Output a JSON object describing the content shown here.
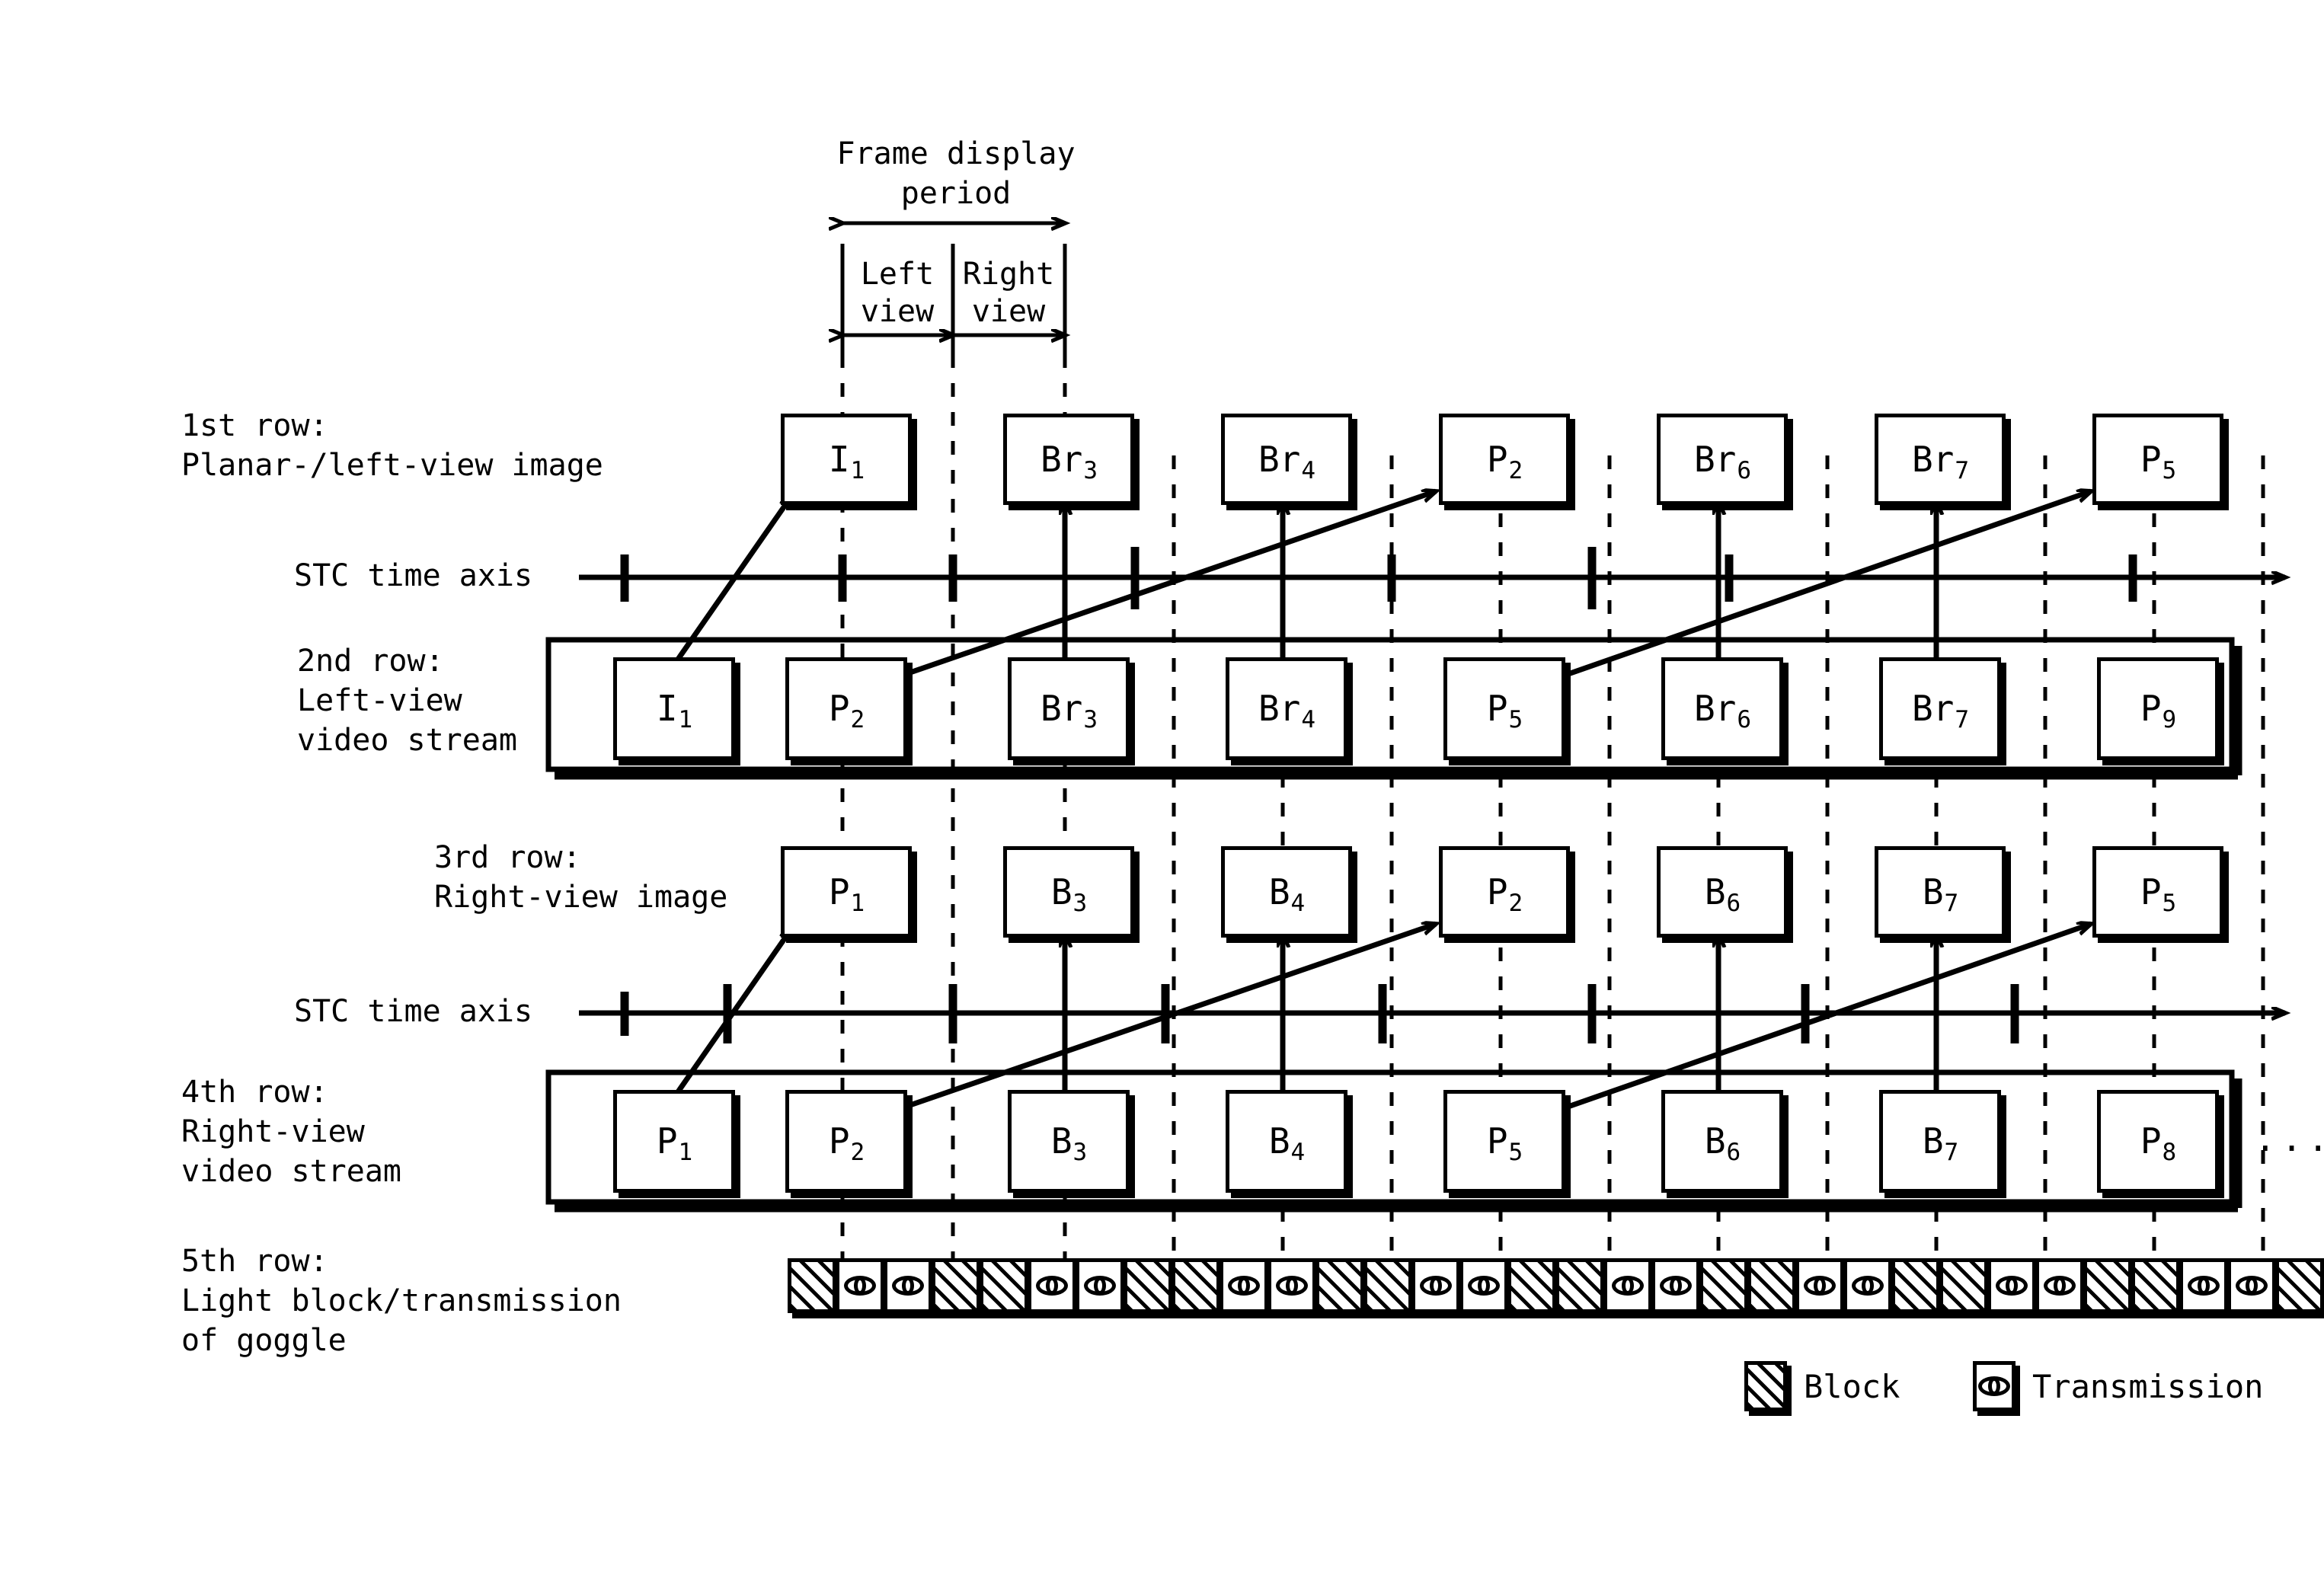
{
  "header": {
    "frame_display_period": "Frame display\nperiod",
    "left_view": "Left\nview",
    "right_view": "Right\nview"
  },
  "rows": {
    "row1_label": "1st row:\nPlanar-/left-view image",
    "row2_label": "2nd row:\nLeft-view\nvideo stream",
    "row3_label": "3rd row:\nRight-view image",
    "row4_label": "4th row:\nRight-view\nvideo stream",
    "row5_label": "5th row:\nLight block/transmission\nof goggle",
    "stc_axis_label_top": "STC time axis",
    "stc_axis_label_bottom": "STC time axis",
    "ellipsis": "..."
  },
  "row1_frames": [
    {
      "base": "I",
      "sub": "1"
    },
    {
      "base": "Br",
      "sub": "3"
    },
    {
      "base": "Br",
      "sub": "4"
    },
    {
      "base": "P",
      "sub": "2"
    },
    {
      "base": "Br",
      "sub": "6"
    },
    {
      "base": "Br",
      "sub": "7"
    },
    {
      "base": "P",
      "sub": "5"
    }
  ],
  "row2_frames": [
    {
      "base": "I",
      "sub": "1"
    },
    {
      "base": "P",
      "sub": "2"
    },
    {
      "base": "Br",
      "sub": "3"
    },
    {
      "base": "Br",
      "sub": "4"
    },
    {
      "base": "P",
      "sub": "5"
    },
    {
      "base": "Br",
      "sub": "6"
    },
    {
      "base": "Br",
      "sub": "7"
    },
    {
      "base": "P",
      "sub": "9"
    }
  ],
  "row3_frames": [
    {
      "base": "P",
      "sub": "1"
    },
    {
      "base": "B",
      "sub": "3"
    },
    {
      "base": "B",
      "sub": "4"
    },
    {
      "base": "P",
      "sub": "2"
    },
    {
      "base": "B",
      "sub": "6"
    },
    {
      "base": "B",
      "sub": "7"
    },
    {
      "base": "P",
      "sub": "5"
    }
  ],
  "row4_frames": [
    {
      "base": "P",
      "sub": "1"
    },
    {
      "base": "P",
      "sub": "2"
    },
    {
      "base": "B",
      "sub": "3"
    },
    {
      "base": "B",
      "sub": "4"
    },
    {
      "base": "P",
      "sub": "5"
    },
    {
      "base": "B",
      "sub": "6"
    },
    {
      "base": "B",
      "sub": "7"
    },
    {
      "base": "P",
      "sub": "8"
    }
  ],
  "goggle_sequence": [
    "block",
    "transmission",
    "transmission",
    "block",
    "block",
    "transmission",
    "transmission",
    "block",
    "block",
    "transmission",
    "transmission",
    "block",
    "block",
    "transmission",
    "transmission",
    "block",
    "block",
    "transmission",
    "transmission",
    "block",
    "block",
    "transmission",
    "transmission",
    "block",
    "block",
    "transmission",
    "transmission",
    "block",
    "block",
    "transmission",
    "transmission",
    "block"
  ],
  "legend": {
    "block_label": "Block",
    "transmission_label": "Transmission"
  },
  "colors": {
    "ink": "#000000",
    "paper": "#ffffff"
  }
}
